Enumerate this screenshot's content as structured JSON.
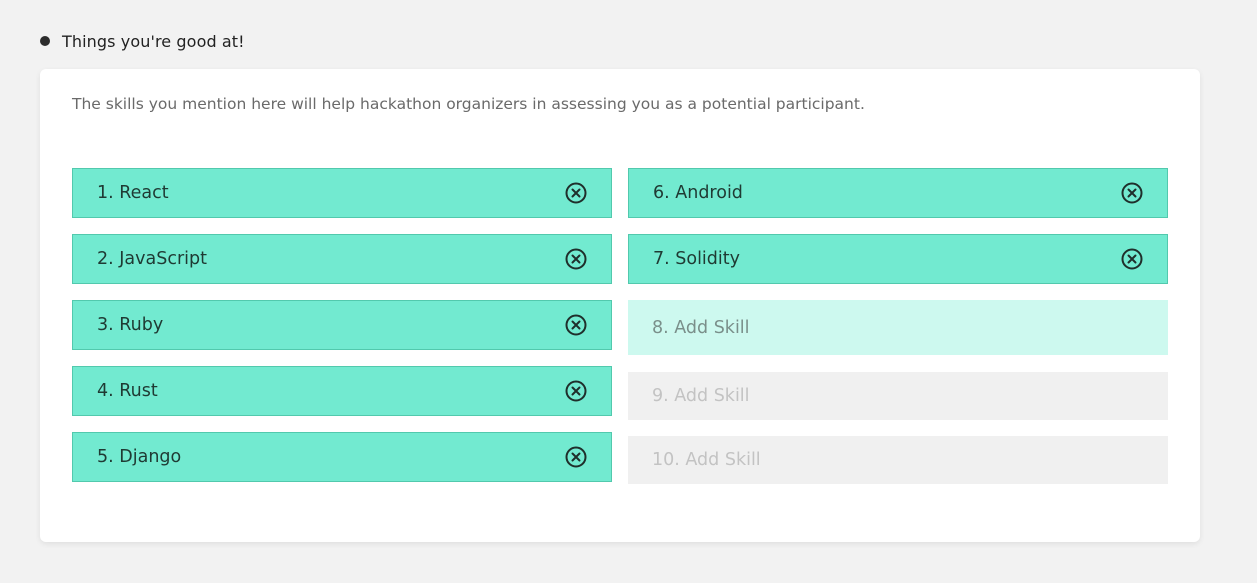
{
  "section": {
    "title": "Things you're good at!"
  },
  "card": {
    "description": "The skills you mention here will help hackathon organizers in assessing you as a potential participant."
  },
  "skills": {
    "left": [
      {
        "label": "1. React"
      },
      {
        "label": "2. JavaScript"
      },
      {
        "label": "3. Ruby"
      },
      {
        "label": "4. Rust"
      },
      {
        "label": "5. Django"
      }
    ],
    "right_filled": [
      {
        "label": "6. Android"
      },
      {
        "label": "7. Solidity"
      }
    ],
    "right_empty": [
      {
        "label": "8. Add Skill"
      },
      {
        "label": "9. Add Skill"
      },
      {
        "label": "10. Add Skill"
      }
    ],
    "remove_icon": "close-circle-icon"
  },
  "colors": {
    "filled_bg": "#72ead0",
    "filled_border": "#52c9ad",
    "active_empty_bg": "#cdf9ef",
    "empty_bg": "#f0f0f0",
    "page_bg": "#f2f2f2"
  }
}
